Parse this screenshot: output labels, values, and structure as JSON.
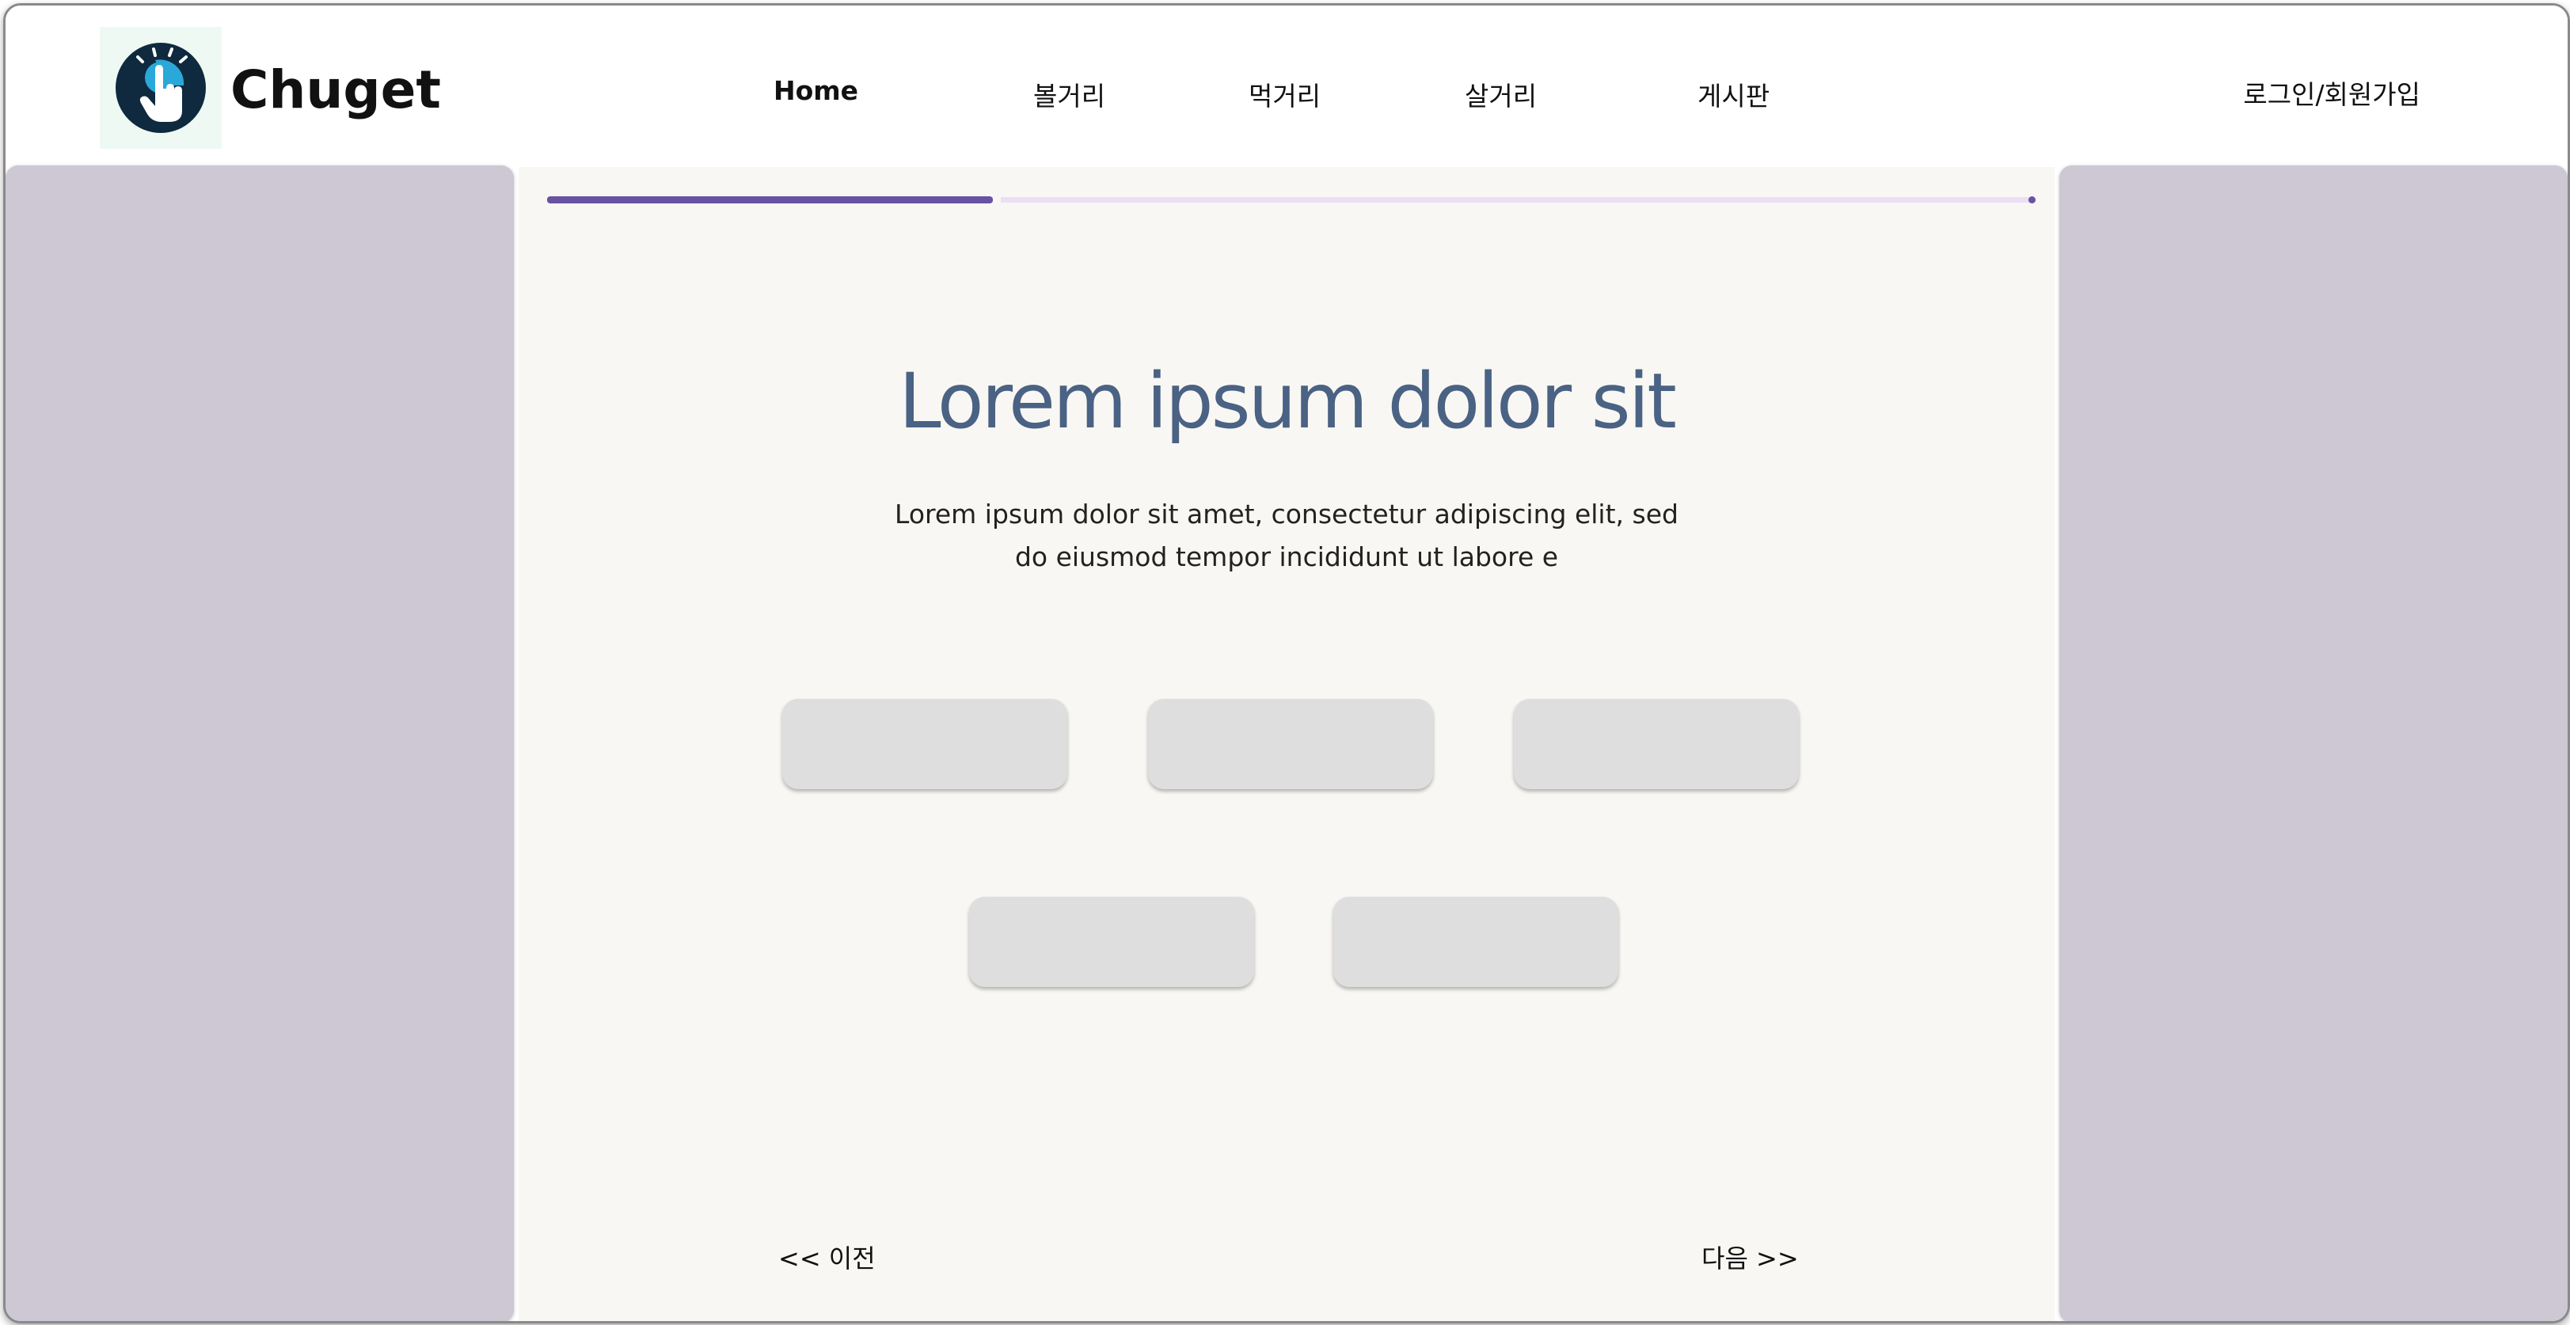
{
  "header": {
    "brand": "Chuget",
    "logo_icon": "tap-hand-icon",
    "nav": [
      {
        "label": "Home"
      },
      {
        "label": "볼거리"
      },
      {
        "label": "먹거리"
      },
      {
        "label": "살거리"
      },
      {
        "label": "게시판"
      }
    ],
    "auth_label": "로그인/회원가입"
  },
  "main": {
    "progress": 0.3,
    "title": "Lorem ipsum dolor sit",
    "description_line1": "Lorem ipsum dolor sit amet, consectetur adipiscing elit, sed",
    "description_line2": "do eiusmod tempor incididunt ut labore e",
    "options": [
      "",
      "",
      "",
      "",
      ""
    ],
    "prev_label": "<< 이전",
    "next_label": "다음 >>"
  },
  "colors": {
    "accent": "#6a52a2",
    "title": "#4a6283",
    "side_panel": "#cdc8d3",
    "main_bg": "#f8f7f3",
    "option_bg": "#dedede"
  }
}
